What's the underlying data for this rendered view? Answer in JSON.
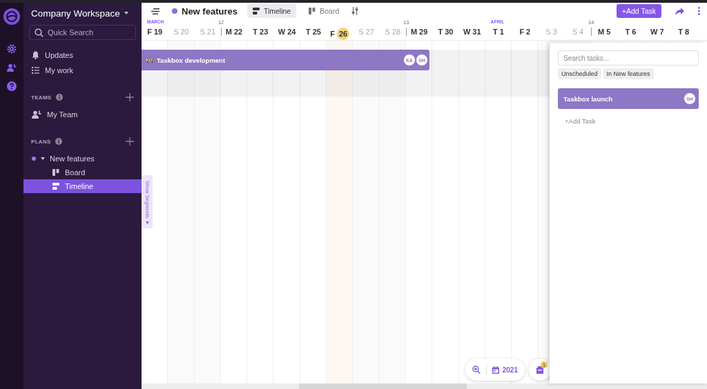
{
  "sidebar": {
    "workspace": "Company Workspace",
    "search": {
      "placeholder": "Quick Search"
    },
    "nav": [
      {
        "label": "Updates",
        "selected": false
      },
      {
        "label": "My work",
        "selected": false
      }
    ],
    "teams": {
      "title": "TEAMS",
      "items": [
        {
          "label": "My Team",
          "selected": false
        }
      ]
    },
    "plans": {
      "title": "PLANS",
      "items": [
        {
          "label": "New features",
          "color": "#9a7ee0",
          "expanded": true,
          "selected": false,
          "children": [
            {
              "label": "Board",
              "selected": false
            },
            {
              "label": "Timeline",
              "selected": true
            }
          ]
        }
      ]
    }
  },
  "toolbar": {
    "plan_title": "New features",
    "views": [
      {
        "label": "Timeline",
        "selected": true
      },
      {
        "label": "Board",
        "selected": false
      }
    ],
    "add_button": "+Add Task"
  },
  "timeline": {
    "days": [
      {
        "weekday": "F",
        "date": "19",
        "month": "MARCH",
        "weekend": false,
        "today": false
      },
      {
        "weekday": "S",
        "date": "20",
        "weekend": true,
        "today": false
      },
      {
        "weekday": "S",
        "date": "21",
        "weekend": true,
        "today": false
      },
      {
        "weekday": "M",
        "date": "22",
        "week": "12",
        "weekend": false,
        "today": false
      },
      {
        "weekday": "T",
        "date": "23",
        "weekend": false,
        "today": false
      },
      {
        "weekday": "W",
        "date": "24",
        "weekend": false,
        "today": false
      },
      {
        "weekday": "T",
        "date": "25",
        "weekend": false,
        "today": false
      },
      {
        "weekday": "F",
        "date": "26",
        "weekend": false,
        "today": true
      },
      {
        "weekday": "S",
        "date": "27",
        "weekend": true,
        "today": false
      },
      {
        "weekday": "S",
        "date": "28",
        "weekend": true,
        "today": false
      },
      {
        "weekday": "M",
        "date": "29",
        "week": "13",
        "weekend": false,
        "today": false
      },
      {
        "weekday": "T",
        "date": "30",
        "weekend": false,
        "today": false
      },
      {
        "weekday": "W",
        "date": "31",
        "weekend": false,
        "today": false
      },
      {
        "weekday": "T",
        "date": "1",
        "month": "APRIL",
        "weekend": false,
        "today": false
      },
      {
        "weekday": "F",
        "date": "2",
        "weekend": false,
        "today": false
      },
      {
        "weekday": "S",
        "date": "3",
        "weekend": true,
        "today": false
      },
      {
        "weekday": "S",
        "date": "4",
        "weekend": true,
        "today": false
      },
      {
        "weekday": "M",
        "date": "5",
        "week": "14",
        "weekend": false,
        "today": false
      },
      {
        "weekday": "T",
        "date": "6",
        "weekend": false,
        "today": false
      },
      {
        "weekday": "W",
        "date": "7",
        "weekend": false,
        "today": false
      },
      {
        "weekday": "T",
        "date": "8",
        "weekend": false,
        "today": false
      }
    ],
    "tasks": [
      {
        "title": "Taskbox development",
        "assignees": [
          "KA",
          "GH"
        ]
      }
    ],
    "segments_tab": "Show Segments"
  },
  "panel": {
    "search": {
      "placeholder": "Search tasks..."
    },
    "filters": [
      "Unscheduled",
      "In New features"
    ],
    "tasks": [
      {
        "title": "Taskbox launch",
        "assignees": [
          "GH"
        ]
      }
    ],
    "add": "+Add Task"
  },
  "footer": {
    "year": "2021",
    "inbox_badge": "1"
  }
}
